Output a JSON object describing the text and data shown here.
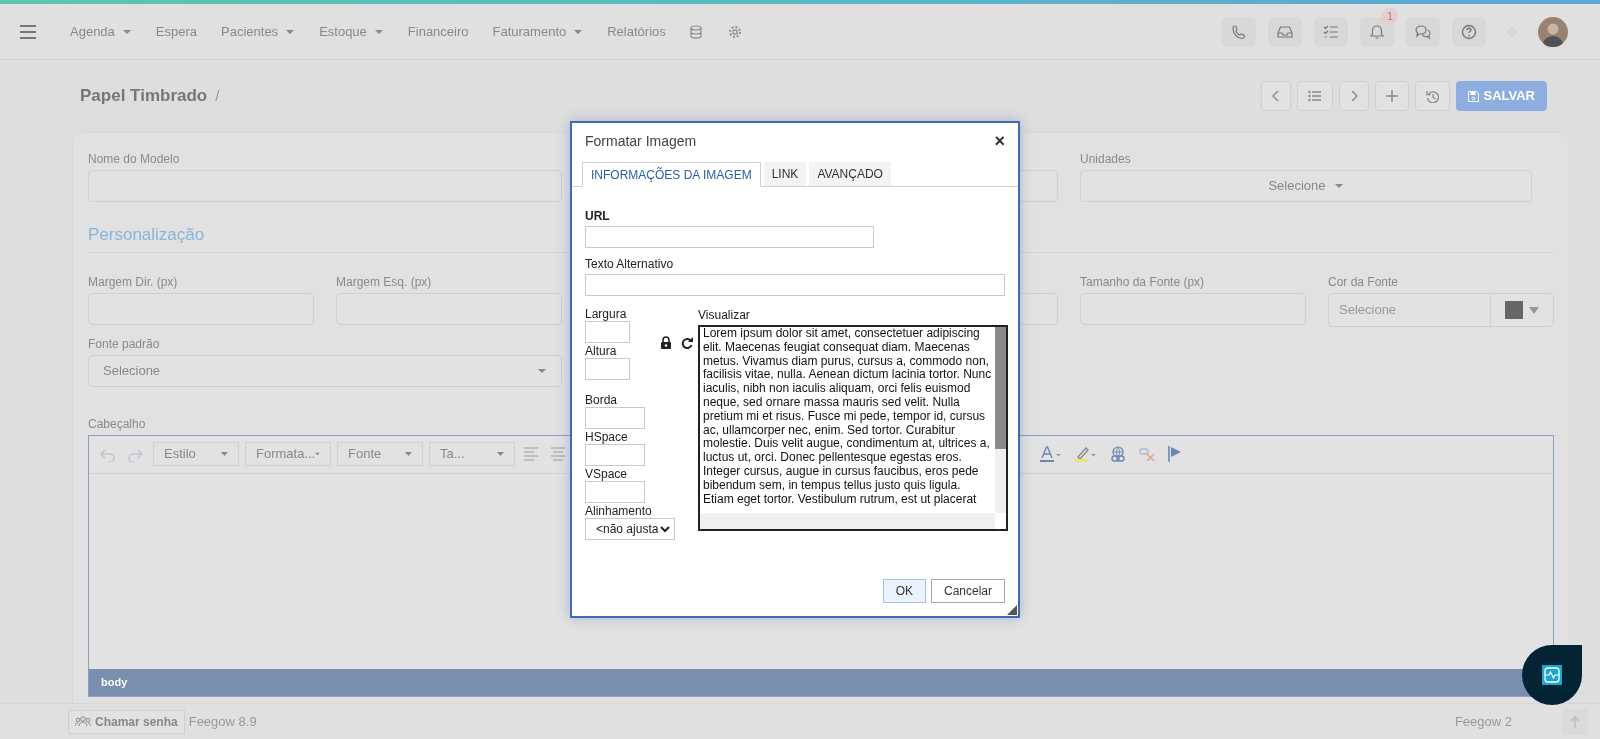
{
  "top_nav": {
    "items": [
      {
        "label": "Agenda",
        "dropdown": true
      },
      {
        "label": "Espera",
        "dropdown": false
      },
      {
        "label": "Pacientes",
        "dropdown": true
      },
      {
        "label": "Estoque",
        "dropdown": true
      },
      {
        "label": "Financeiro",
        "dropdown": false
      },
      {
        "label": "Faturamento",
        "dropdown": true
      },
      {
        "label": "Relatórios",
        "dropdown": false
      }
    ],
    "actions": [
      {
        "kind": "phone"
      },
      {
        "kind": "inbox"
      },
      {
        "kind": "tasks"
      },
      {
        "kind": "bell",
        "badge": "1"
      },
      {
        "kind": "chat"
      },
      {
        "kind": "help"
      }
    ]
  },
  "page": {
    "title": "Papel Timbrado",
    "separator": "/",
    "save_button": "SALVAR"
  },
  "form": {
    "name_field": {
      "label": "Nome do Modelo"
    },
    "units_field": {
      "label": "Unidades",
      "placeholder": "Selecione"
    },
    "section_title": "Personalização",
    "row_fields": [
      {
        "kind": "input",
        "label": "Margem Dir. (px)"
      },
      {
        "kind": "input",
        "label": "Margem Esq. (px)"
      },
      {
        "kind": "covered"
      },
      {
        "kind": "input"
      },
      {
        "kind": "input",
        "label": "Tamanho da Fonte (px)"
      },
      {
        "kind": "color_select",
        "label": "Cor da Fonte",
        "placeholder": "Selecione",
        "color": "#666666"
      }
    ],
    "font_field": {
      "label": "Fonte padrão",
      "placeholder": "Selecione"
    },
    "editor": {
      "label": "Cabeçalho",
      "path": "body",
      "toolbar": [
        {
          "kind": "undo"
        },
        {
          "kind": "redo"
        },
        {
          "kind": "combo",
          "label": "Estilo"
        },
        {
          "kind": "combo",
          "label": "Formata..."
        },
        {
          "kind": "combo",
          "label": "Fonte"
        },
        {
          "kind": "combo",
          "label": "Ta..."
        },
        {
          "kind": "align-left"
        },
        {
          "kind": "align-center"
        },
        {
          "kind": "gap"
        },
        {
          "kind": "text-color"
        },
        {
          "kind": "highlight"
        },
        {
          "kind": "link"
        },
        {
          "kind": "unlink"
        },
        {
          "kind": "flag"
        }
      ]
    }
  },
  "dialog": {
    "title": "Formatar Imagem",
    "close": "×",
    "tabs": [
      {
        "label": "INFORMAÇÕES DA IMAGEM",
        "selected": true
      },
      {
        "label": "LINK",
        "selected": false
      },
      {
        "label": "AVANÇADO",
        "selected": false
      }
    ],
    "url_label": "URL",
    "alt_label": "Texto Alternativo",
    "width_label": "Largura",
    "height_label": "Altura",
    "border_label": "Borda",
    "hspace_label": "HSpace",
    "vspace_label": "VSpace",
    "align_label": "Alinhamento",
    "align_value": "<não ajusta",
    "preview_label": "Visualizar",
    "preview_text": "Lorem ipsum dolor sit amet, consectetuer adipiscing elit. Maecenas feugiat consequat diam. Maecenas metus. Vivamus diam purus, cursus a, commodo non, facilisis vitae, nulla. Aenean dictum lacinia tortor. Nunc iaculis, nibh non iaculis aliquam, orci felis euismod neque, sed ornare massa mauris sed velit. Nulla pretium mi et risus. Fusce mi pede, tempor id, cursus ac, ullamcorper nec, enim. Sed tortor. Curabitur molestie. Duis velit augue, condimentum at, ultrices a, luctus ut, orci. Donec pellentesque egestas eros. Integer cursus, augue in cursus faucibus, eros pede bibendum sem, in tempus tellus justo quis ligula. Etiam eget tortor. Vestibulum rutrum, est ut placerat",
    "buttons": [
      {
        "label": "OK",
        "kind": "primary"
      },
      {
        "label": "Cancelar",
        "kind": "default"
      }
    ]
  },
  "footer": {
    "call_button": "Chamar senha",
    "version": "Feegow 8.9",
    "right_label": "Feegow 2"
  }
}
